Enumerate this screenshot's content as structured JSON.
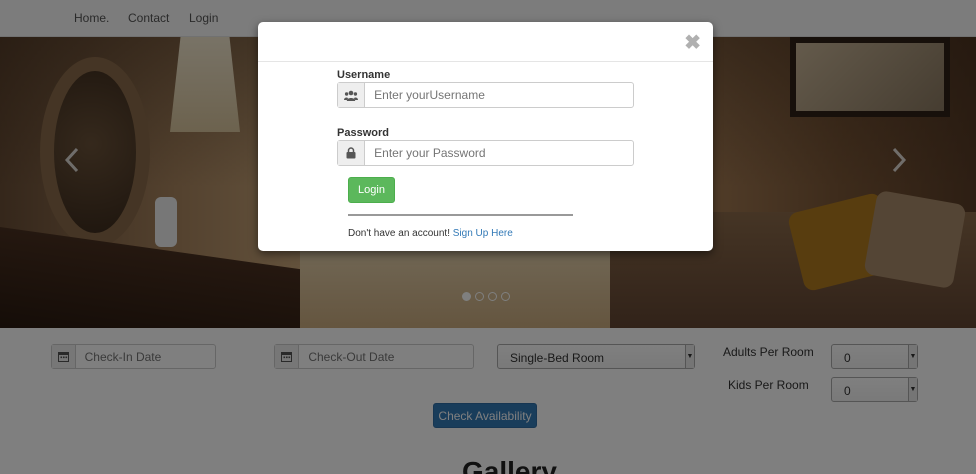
{
  "nav": {
    "items": [
      {
        "label": "Home."
      },
      {
        "label": "Contact"
      },
      {
        "label": "Login"
      }
    ]
  },
  "carousel": {
    "slide_count": 4,
    "active_slide": 1,
    "prev_icon": "chevron-left-icon",
    "next_icon": "chevron-right-icon"
  },
  "booking": {
    "checkin_placeholder": "Check-In Date",
    "checkout_placeholder": "Check-Out Date",
    "room_type": "Single-Bed Room",
    "adults_label": "Adults Per Room",
    "adults_value": "0",
    "kids_label": "Kids Per Room",
    "kids_value": "0",
    "check_button": "Check Availability",
    "calendar_icon": "calendar-icon"
  },
  "gallery": {
    "title": "Gallery"
  },
  "modal": {
    "close_symbol": "✖",
    "username_label": "Username",
    "username_placeholder": "Enter yourUsername",
    "username_icon": "users-icon",
    "password_label": "Password",
    "password_placeholder": "Enter your Password",
    "password_icon": "lock-icon",
    "login_button": "Login",
    "signup_prompt": "Don't have an account!",
    "signup_link": "Sign Up Here"
  },
  "colors": {
    "primary": "#337ab7",
    "success": "#5cb85c",
    "backdrop": "rgba(0,0,0,0.5)"
  }
}
